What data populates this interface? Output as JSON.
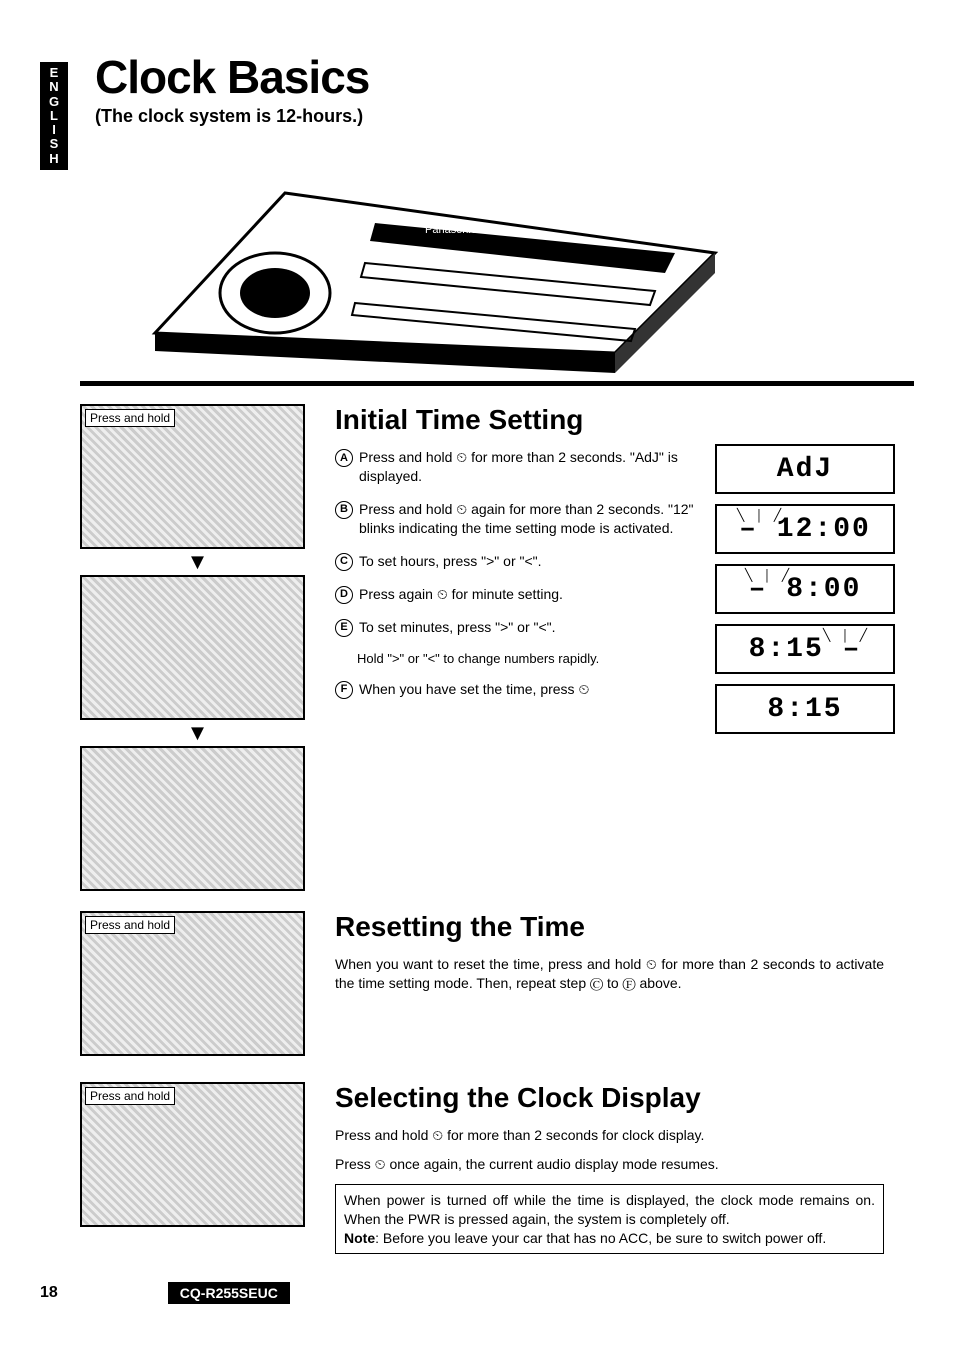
{
  "lang_tab": "ENGLISH",
  "title": "Clock Basics",
  "subtitle": "(The clock system is 12-hours.)",
  "thumbs": [
    {
      "caption": "Press and hold"
    },
    {
      "caption": ""
    },
    {
      "caption": ""
    },
    {
      "caption": "Press and hold"
    },
    {
      "caption": "Press and hold"
    }
  ],
  "section1": {
    "heading": "Initial Time Setting",
    "steps": {
      "A": "Press and hold ⏲ for more than 2 seconds. \"AdJ\" is displayed.",
      "B": "Press and hold ⏲ again for more than 2 seconds. \"12\" blinks indicating the time setting mode is activated.",
      "C": "To set hours, press \">\" or \"<\".",
      "D": "Press again ⏲ for minute setting.",
      "E": "To set minutes, press \">\" or \"<\".",
      "hold": "Hold \">\" or \"<\" to change numbers rapidly.",
      "F": "When you have set the time, press ⏲"
    }
  },
  "lcd": [
    "AdJ",
    "12:00",
    "8:00",
    "8:15",
    "8:15"
  ],
  "section2": {
    "heading": "Resetting the Time",
    "body": "When you want to reset the time, press and hold ⏲ for more than 2 seconds to activate the time setting mode. Then, repeat step Ⓒ to Ⓕ above."
  },
  "section3": {
    "heading": "Selecting the Clock Display",
    "line1": "Press and hold ⏲ for more than 2 seconds for clock display.",
    "line2": "Press ⏲ once again, the current audio display mode resumes.",
    "note_body": "When power is turned off while the time is displayed, the clock mode remains on. When the PWR is pressed again, the system is completely off.",
    "note_label": "Note",
    "note_tail": ": Before you leave your car that has no ACC, be sure to switch power off."
  },
  "page_number": "18",
  "model": "CQ-R255SEUC"
}
